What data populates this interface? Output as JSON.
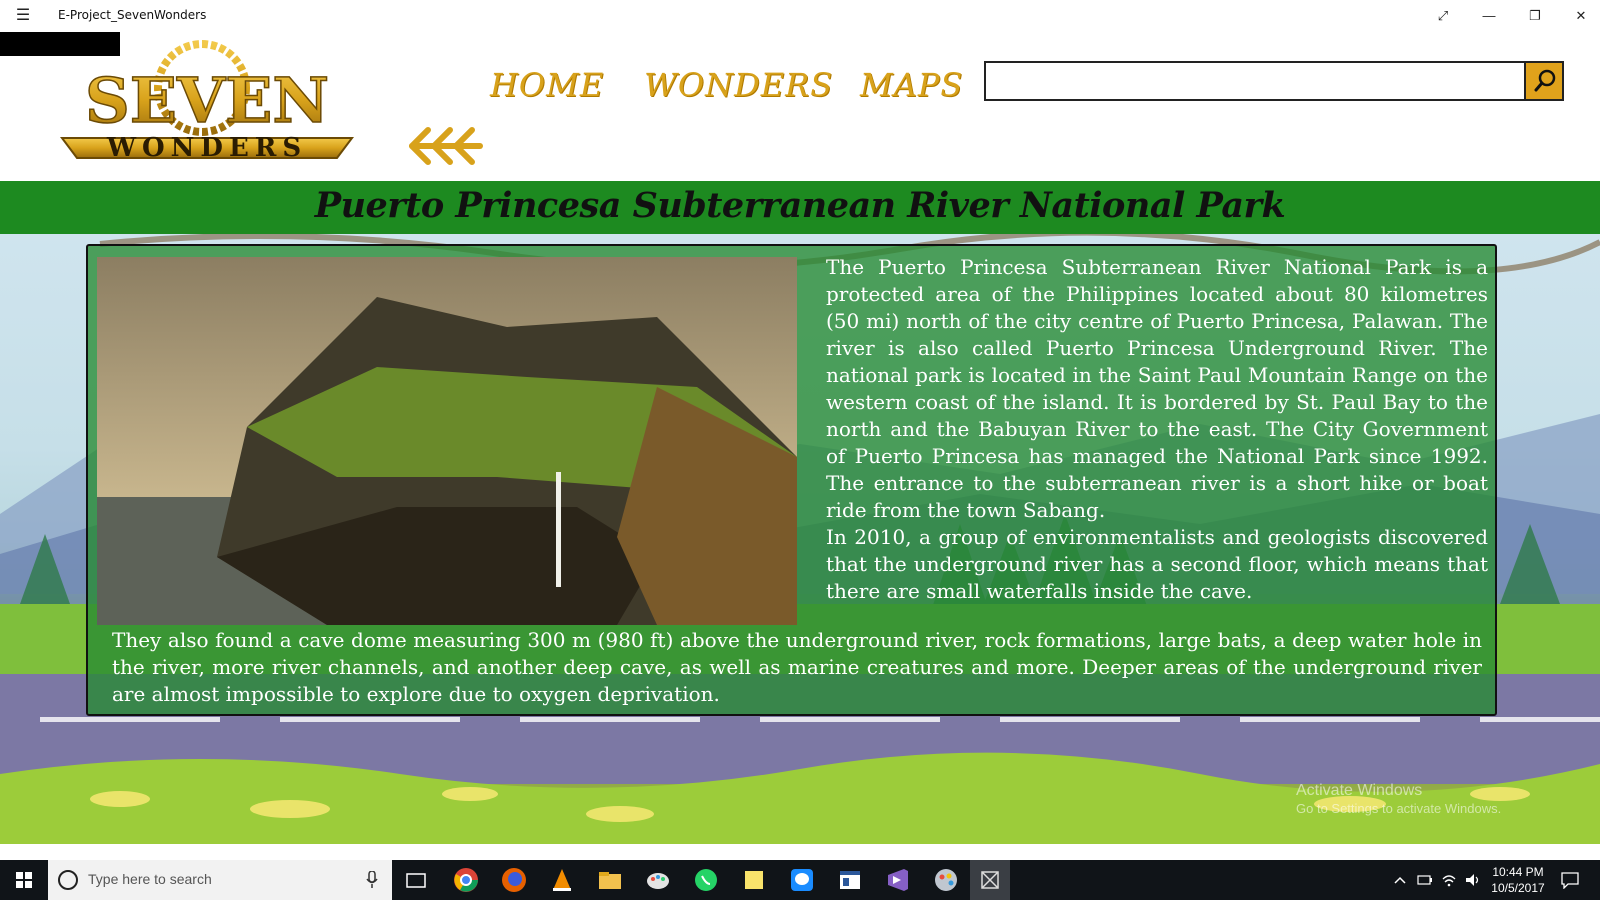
{
  "window": {
    "title": "E-Project_SevenWonders",
    "controls": [
      "expand-icon",
      "minimize-icon",
      "restore-icon",
      "close-icon"
    ]
  },
  "header": {
    "logo_top": "SEVEN",
    "logo_bottom": "WONDERS",
    "nav": [
      {
        "label": "HOME"
      },
      {
        "label": "WONDERS"
      },
      {
        "label": "MAPS"
      }
    ],
    "search": {
      "value": "",
      "placeholder": ""
    }
  },
  "page": {
    "title": "Puerto Princesa Subterranean River National Park",
    "paragraph1": "The Puerto Princesa Subterranean River National Park is a protected area of the Philippines located about 80 kilometres (50 mi) north of the city centre of Puerto Princesa, Palawan. The river is also called Puerto Princesa Underground River. The national park is located in the Saint Paul Mountain Range on the western coast of the island. It is bordered by St. Paul Bay to the north and the Babuyan River to the east. The City Government of Puerto Princesa has managed the National Park since 1992. The entrance to the subterranean river is a short hike or boat ride from the town Sabang.",
    "paragraph2": "In 2010, a group of environmentalists and geologists discovered that the underground river has a second floor, which means that there are small waterfalls inside the cave.",
    "paragraph3": "They also found a cave dome measuring 300 m (980 ft) above the underground river, rock formations, large bats, a deep water hole in the river, more river channels, and another deep cave, as well as marine creatures and more. Deeper areas of the underground river are almost impossible to explore due to oxygen deprivation."
  },
  "watermark": {
    "line1": "Activate Windows",
    "line2": "Go to Settings to activate Windows."
  },
  "taskbar": {
    "search_placeholder": "Type here to search",
    "apps": [
      "task-view-icon",
      "chrome-icon",
      "firefox-icon",
      "vlc-icon",
      "file-explorer-icon",
      "paint-icon",
      "whatsapp-icon",
      "sticky-notes-icon",
      "messenger-icon",
      "app-window-icon",
      "visual-studio-icon",
      "paint-palette-icon",
      "active-app-icon"
    ],
    "time": "10:44 PM",
    "date": "10/5/2017"
  },
  "colors": {
    "accent_gold": "#d8a21b",
    "band_green": "#1d8a20",
    "panel_green": "#268a32"
  }
}
